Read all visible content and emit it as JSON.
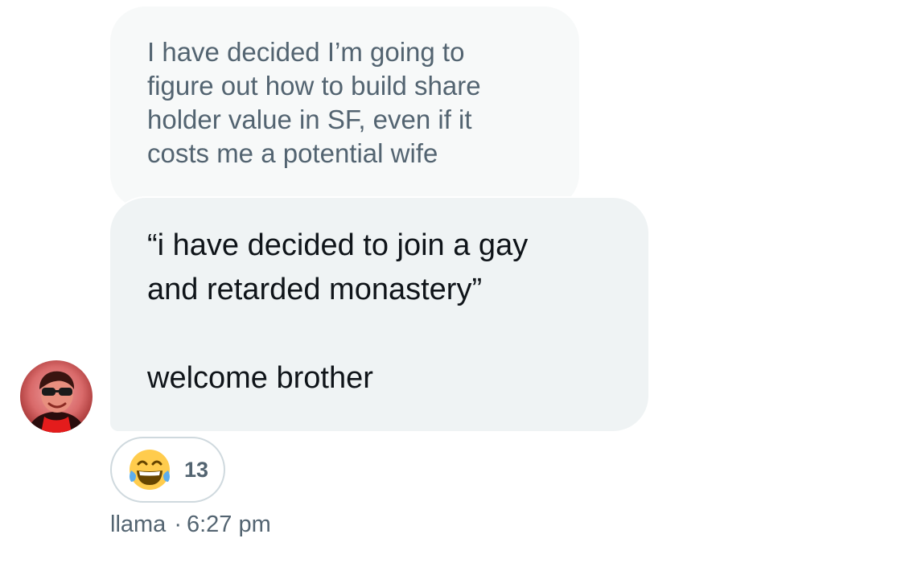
{
  "quoted_message": {
    "text": "I have decided I’m going to\nfigure out how to build share\nholder value in SF, even if it\ncosts me a potential wife"
  },
  "reply_message": {
    "text": "“i have decided to join a gay\nand retarded monastery”\n\nwelcome brother"
  },
  "reaction": {
    "emoji_icon": "tears-of-joy-emoji",
    "count": "13"
  },
  "sender": {
    "avatar_icon": "user-avatar",
    "name": "llama",
    "separator": "·",
    "time": "6:27 pm"
  },
  "colors": {
    "quoted_bubble_bg": "#f7f9f9",
    "reply_bubble_bg": "#eff3f4",
    "secondary_text": "#536471",
    "primary_text": "#0f1419",
    "pill_border": "#cfd9de"
  }
}
